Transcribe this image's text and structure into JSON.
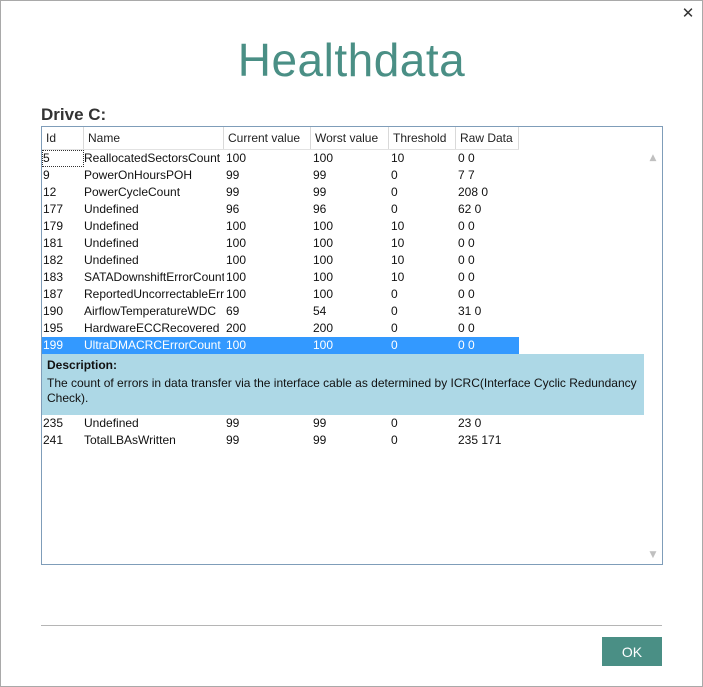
{
  "window": {
    "title": "Healthdata",
    "close_glyph": "✕"
  },
  "drive": {
    "label": "Drive C:"
  },
  "table": {
    "columns": [
      "Id",
      "Name",
      "Current value",
      "Worst value",
      "Threshold",
      "Raw Data"
    ],
    "rows_before": [
      {
        "id": "5",
        "name": "ReallocatedSectorsCount",
        "current": "100",
        "worst": "100",
        "threshold": "10",
        "raw": "0 0"
      },
      {
        "id": "9",
        "name": "PowerOnHoursPOH",
        "current": "99",
        "worst": "99",
        "threshold": "0",
        "raw": "7 7"
      },
      {
        "id": "12",
        "name": "PowerCycleCount",
        "current": "99",
        "worst": "99",
        "threshold": "0",
        "raw": "208 0"
      },
      {
        "id": "177",
        "name": "Undefined",
        "current": "96",
        "worst": "96",
        "threshold": "0",
        "raw": "62 0"
      },
      {
        "id": "179",
        "name": "Undefined",
        "current": "100",
        "worst": "100",
        "threshold": "10",
        "raw": "0 0"
      },
      {
        "id": "181",
        "name": "Undefined",
        "current": "100",
        "worst": "100",
        "threshold": "10",
        "raw": "0 0"
      },
      {
        "id": "182",
        "name": "Undefined",
        "current": "100",
        "worst": "100",
        "threshold": "10",
        "raw": "0 0"
      },
      {
        "id": "183",
        "name": "SATADownshiftErrorCount",
        "current": "100",
        "worst": "100",
        "threshold": "10",
        "raw": "0 0"
      },
      {
        "id": "187",
        "name": "ReportedUncorrectableErrors",
        "current": "100",
        "worst": "100",
        "threshold": "0",
        "raw": "0 0"
      },
      {
        "id": "190",
        "name": "AirflowTemperatureWDC",
        "current": "69",
        "worst": "54",
        "threshold": "0",
        "raw": "31 0"
      },
      {
        "id": "195",
        "name": "HardwareECCRecovered",
        "current": "200",
        "worst": "200",
        "threshold": "0",
        "raw": "0 0"
      }
    ],
    "selected_row": {
      "id": "199",
      "name": "UltraDMACRCErrorCount",
      "current": "100",
      "worst": "100",
      "threshold": "0",
      "raw": "0 0"
    },
    "description": {
      "title": "Description:",
      "text": "The count of errors in data transfer via the interface cable as determined by ICRC(Interface Cyclic Redundancy Check)."
    },
    "rows_after": [
      {
        "id": "235",
        "name": "Undefined",
        "current": "99",
        "worst": "99",
        "threshold": "0",
        "raw": "23 0"
      },
      {
        "id": "241",
        "name": "TotalLBAsWritten",
        "current": "99",
        "worst": "99",
        "threshold": "0",
        "raw": "235 171"
      }
    ]
  },
  "buttons": {
    "ok_label": "OK"
  },
  "colors": {
    "accent": "#4a8f85",
    "selection": "#3399ff",
    "description_bg": "#add8e6"
  },
  "icons": {
    "close": "close-icon",
    "scroll_up": "scroll-up-icon",
    "scroll_down": "scroll-down-icon"
  }
}
